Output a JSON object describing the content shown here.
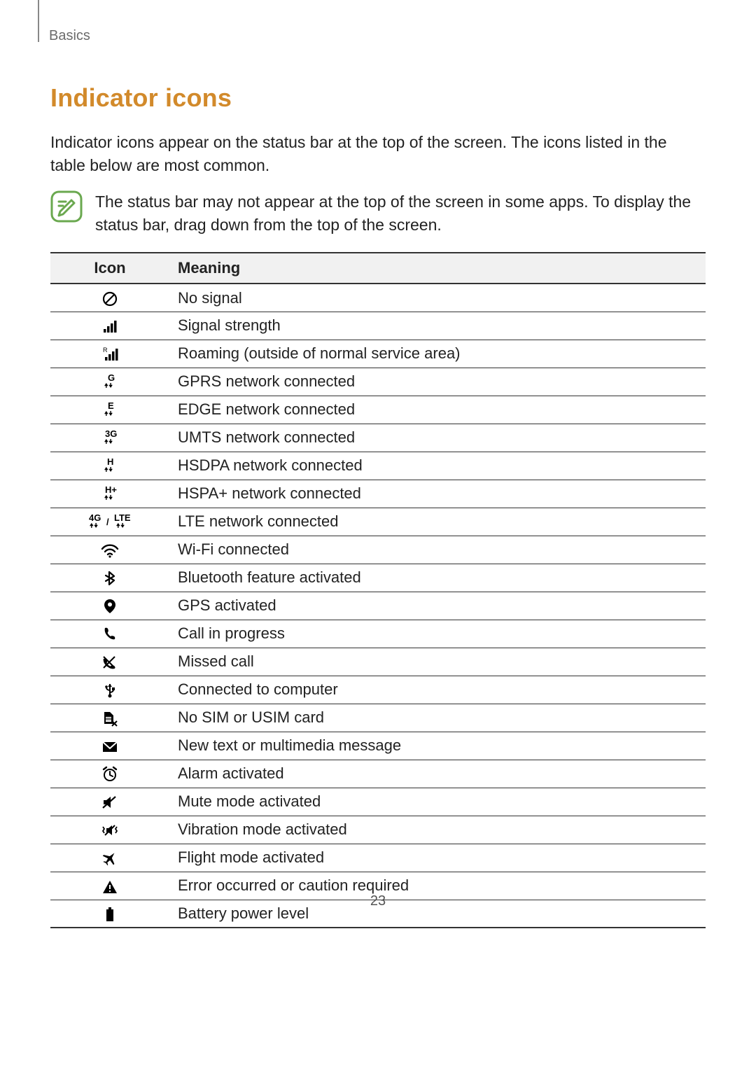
{
  "breadcrumb": "Basics",
  "title": "Indicator icons",
  "intro": "Indicator icons appear on the status bar at the top of the screen. The icons listed in the table below are most common.",
  "note": "The status bar may not appear at the top of the screen in some apps. To display the status bar, drag down from the top of the screen.",
  "table": {
    "head_icon": "Icon",
    "head_meaning": "Meaning",
    "rows": [
      {
        "icon": "no-signal-icon",
        "meaning": "No signal"
      },
      {
        "icon": "signal-icon",
        "meaning": "Signal strength"
      },
      {
        "icon": "roaming-icon",
        "meaning": "Roaming (outside of normal service area)"
      },
      {
        "icon": "gprs-icon",
        "meaning": "GPRS network connected"
      },
      {
        "icon": "edge-icon",
        "meaning": "EDGE network connected"
      },
      {
        "icon": "umts-icon",
        "meaning": "UMTS network connected"
      },
      {
        "icon": "hsdpa-icon",
        "meaning": "HSDPA network connected"
      },
      {
        "icon": "hspa-plus-icon",
        "meaning": "HSPA+ network connected"
      },
      {
        "icon": "lte-icon",
        "meaning": "LTE network connected"
      },
      {
        "icon": "wifi-icon",
        "meaning": "Wi-Fi connected"
      },
      {
        "icon": "bluetooth-icon",
        "meaning": "Bluetooth feature activated"
      },
      {
        "icon": "gps-icon",
        "meaning": "GPS activated"
      },
      {
        "icon": "call-icon",
        "meaning": "Call in progress"
      },
      {
        "icon": "missed-call-icon",
        "meaning": "Missed call"
      },
      {
        "icon": "usb-icon",
        "meaning": "Connected to computer"
      },
      {
        "icon": "no-sim-icon",
        "meaning": "No SIM or USIM card"
      },
      {
        "icon": "message-icon",
        "meaning": "New text or multimedia message"
      },
      {
        "icon": "alarm-icon",
        "meaning": "Alarm activated"
      },
      {
        "icon": "mute-icon",
        "meaning": "Mute mode activated"
      },
      {
        "icon": "vibration-icon",
        "meaning": "Vibration mode activated"
      },
      {
        "icon": "flight-mode-icon",
        "meaning": "Flight mode activated"
      },
      {
        "icon": "error-icon",
        "meaning": "Error occurred or caution required"
      },
      {
        "icon": "battery-icon",
        "meaning": "Battery power level"
      }
    ]
  },
  "page_number": "23"
}
